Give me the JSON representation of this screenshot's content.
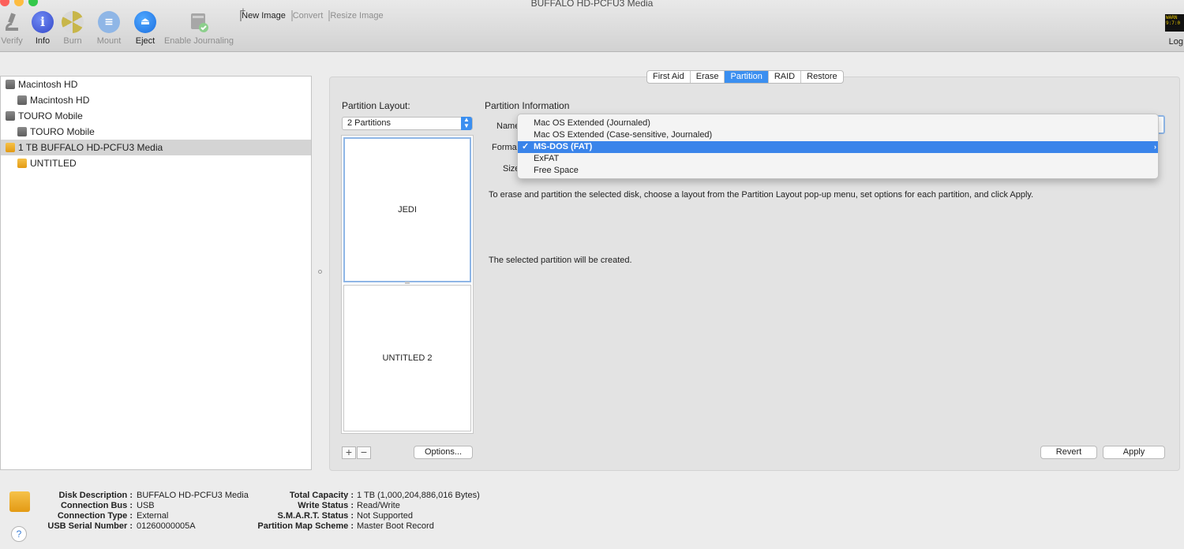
{
  "window": {
    "title": "BUFFALO HD-PCFU3 Media"
  },
  "toolbar": {
    "verify": "Verify",
    "info": "Info",
    "burn": "Burn",
    "mount": "Mount",
    "eject": "Eject",
    "enable_journaling": "Enable Journaling",
    "new_image": "New Image",
    "convert": "Convert",
    "resize_image": "Resize Image",
    "log": "Log",
    "log_icon_text": "WARN 9:7:0"
  },
  "sidebar": {
    "items": [
      {
        "label": "Macintosh HD",
        "level": 0,
        "icon": "internal-disk-icon"
      },
      {
        "label": "Macintosh HD",
        "level": 1,
        "icon": "volume-icon"
      },
      {
        "label": "TOURO Mobile",
        "level": 0,
        "icon": "external-disk-icon"
      },
      {
        "label": "TOURO Mobile",
        "level": 1,
        "icon": "volume-icon"
      },
      {
        "label": "1 TB BUFFALO HD-PCFU3 Media",
        "level": 0,
        "icon": "usb-disk-icon",
        "selected": true
      },
      {
        "label": "UNTITLED",
        "level": 1,
        "icon": "usb-volume-icon"
      }
    ]
  },
  "tabs": [
    "First Aid",
    "Erase",
    "Partition",
    "RAID",
    "Restore"
  ],
  "active_tab": "Partition",
  "partition": {
    "layout_heading": "Partition Layout:",
    "layout_value": "2 Partitions",
    "partitions": [
      "JEDI",
      "UNTITLED 2"
    ],
    "options_button": "Options...",
    "info_heading": "Partition Information",
    "name_label": "Name:",
    "format_label": "Format:",
    "size_label": "Size:",
    "instructions": "To erase and partition the selected disk, choose a layout from the Partition Layout pop-up menu, set options for each partition, and click Apply.",
    "status": "The selected partition will be created.",
    "revert_button": "Revert",
    "apply_button": "Apply"
  },
  "format_menu": {
    "items": [
      "Mac OS Extended (Journaled)",
      "Mac OS Extended (Case-sensitive, Journaled)",
      "MS-DOS (FAT)",
      "ExFAT",
      "Free Space"
    ],
    "selected": "MS-DOS (FAT)"
  },
  "footer": {
    "left": [
      {
        "label": "Disk Description :",
        "value": "BUFFALO HD-PCFU3 Media"
      },
      {
        "label": "Connection Bus :",
        "value": "USB"
      },
      {
        "label": "Connection Type :",
        "value": "External"
      },
      {
        "label": "USB Serial Number :",
        "value": "01260000005A"
      }
    ],
    "right": [
      {
        "label": "Total Capacity :",
        "value": "1 TB (1,000,204,886,016 Bytes)"
      },
      {
        "label": "Write Status :",
        "value": "Read/Write"
      },
      {
        "label": "S.M.A.R.T. Status :",
        "value": "Not Supported"
      },
      {
        "label": "Partition Map Scheme :",
        "value": "Master Boot Record"
      }
    ],
    "help": "?"
  },
  "colors": {
    "accent": "#3b8ff0",
    "menu_selection": "#3a84ea",
    "disk_orange": "#f0b030"
  }
}
